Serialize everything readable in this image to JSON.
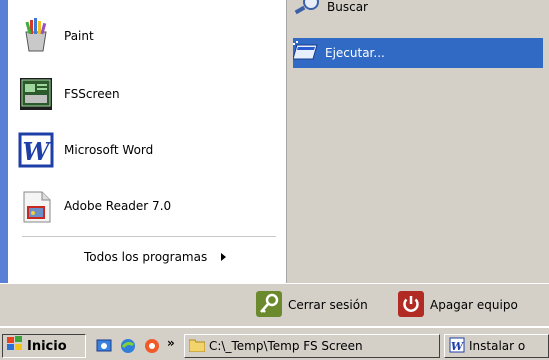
{
  "left_column": {
    "programs": [
      {
        "label": "Paint",
        "icon": "paint-icon"
      },
      {
        "label": "FSScreen",
        "icon": "fsscreen-icon"
      },
      {
        "label": "Microsoft Word",
        "icon": "word-icon"
      },
      {
        "label": "Adobe Reader 7.0",
        "icon": "adobe-reader-icon"
      }
    ],
    "all_programs_label": "Todos los programas"
  },
  "right_column": {
    "items": [
      {
        "label": "Buscar",
        "icon": "search-icon"
      },
      {
        "label": "Ejecutar...",
        "icon": "run-icon",
        "selected": true
      }
    ]
  },
  "bottom_bar": {
    "logoff_label": "Cerrar sesión",
    "shutdown_label": "Apagar equipo"
  },
  "taskbar": {
    "start_label": "Inicio",
    "chevron": "»",
    "tasks": [
      {
        "label": "C:\\_Temp\\Temp FS Screen",
        "icon": "folder-icon"
      },
      {
        "label": "Instalar o",
        "icon": "word-doc-icon"
      }
    ]
  },
  "colors": {
    "selection": "#316ac5",
    "menu_gray": "#d4d0c8",
    "shutdown_red": "#b22a24",
    "logoff_green": "#6b8a2e"
  }
}
